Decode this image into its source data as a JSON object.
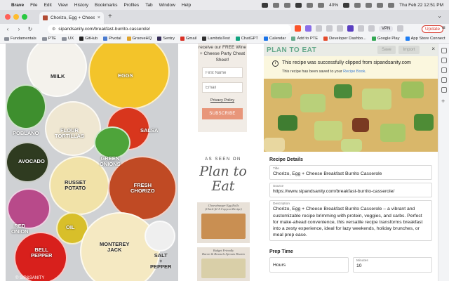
{
  "menubar": {
    "apple": "",
    "app_name": "Brave",
    "items": [
      "File",
      "Edit",
      "View",
      "History",
      "Bookmarks",
      "Profiles",
      "Tab",
      "Window",
      "Help"
    ],
    "battery": "40%",
    "clock": "Thu Feb 22  12:51 PM"
  },
  "tab": {
    "title": "Chorizo, Egg + Cheese Breakfast Burrito Casserole",
    "close": "×",
    "new_tab": "+",
    "dropdown": "⌄"
  },
  "addressbar": {
    "back": "‹",
    "forward": "›",
    "reload": "↻",
    "url": "sipandsanity.com/breakfast-burrito-casserole/",
    "vpn": "VPN",
    "update_label": "Update",
    "menu": "≡"
  },
  "bookmarks": [
    {
      "label": "Fundamentals",
      "kind": "folder"
    },
    {
      "label": "PTE",
      "kind": "folder"
    },
    {
      "label": "UX",
      "kind": "folder"
    },
    {
      "label": "GitHub",
      "kind": "site",
      "color": "#222222"
    },
    {
      "label": "Pivotal",
      "kind": "site",
      "color": "#4a7bd0"
    },
    {
      "label": "GrooveHQ",
      "kind": "site",
      "color": "#e0a42b"
    },
    {
      "label": "Sentry",
      "kind": "site",
      "color": "#362d59"
    },
    {
      "label": "Gmail",
      "kind": "site",
      "color": "#d93025"
    },
    {
      "label": "LambdaTest",
      "kind": "site",
      "color": "#2f2f2f"
    },
    {
      "label": "ChatGPT",
      "kind": "site",
      "color": "#10a37f"
    },
    {
      "label": "Calendar",
      "kind": "site",
      "color": "#1a73e8"
    },
    {
      "label": "Add to PTE",
      "kind": "site",
      "color": "#64a88a"
    },
    {
      "label": "Developer Dashbo...",
      "kind": "site",
      "color": "#e44a2b"
    },
    {
      "label": "Google Play",
      "kind": "site",
      "color": "#34a853"
    },
    {
      "label": "App Store Connect",
      "kind": "site",
      "color": "#1c7cf3"
    }
  ],
  "photo": {
    "ingredients": [
      "MIILK",
      "EGGS",
      "POBLANO",
      "FLOUR\nTORTILLAS",
      "SALSA",
      "AVOCADO",
      "GREEN\nONIONS",
      "RUSSET\nPOTATO",
      "FRESH\nCHORIZO",
      "RED\nONION",
      "OIL",
      "BELL\nPEPPER",
      "MONTEREY\nJACK",
      "SALT\n+\nPEPPER"
    ],
    "credit": "© SIP&SANITY"
  },
  "sidebar": {
    "signup_text": "receive our FREE Wine + Cheese Party Cheat Sheet!",
    "first_name_placeholder": "First Name",
    "email_placeholder": "Email",
    "privacy_label": "Privacy Policy",
    "subscribe_label": "SUBSCRIBE",
    "as_seen_on": "AS SEEN ON",
    "brand_line1": "Plan to",
    "brand_line2": "Eat",
    "thumb1_caption": "Cheeseburger Egg Rolls\n(Chick-fil-A Copycat Recipe)",
    "thumb2_caption": "Budget Friendly\nBacon & Brussels Sprouts Risotto"
  },
  "panel": {
    "logo": "PLAN TO EAT",
    "save_label": "Save",
    "import_label": "Import",
    "close": "×",
    "notice_icon": "i",
    "notice_title": "This recipe was successfully clipped from sipandsanity.com",
    "notice_sub_prefix": "This recipe has been saved to your ",
    "notice_sub_link": "Recipe Book",
    "notice_sub_suffix": ".",
    "recipe_details_heading": "Recipe Details",
    "title_label": "Title",
    "title_value": "Chorizo, Egg + Cheese Breakfast Burrito Casserole",
    "source_label": "Source",
    "source_value": "https://www.sipandsanity.com/breakfast-burrito-casserole/",
    "description_label": "Description",
    "description_value": "Chorizo, Egg + Cheese Breakfast Burrito Casserole – a vibrant and customizable recipe brimming with protein, veggies, and carbs. Perfect for make-ahead convenience, this versatile recipe transforms breakfast into a zesty experience, ideal for lazy weekends, holiday brunches, or meal prep ease.",
    "prep_time_heading": "Prep Time",
    "hours_placeholder": "Hours",
    "minutes_label": "Minutes",
    "minutes_value": "10"
  },
  "colors": {
    "accent_green": "#64a88a",
    "notice_bg": "#fbf7de",
    "update_red": "#d83a2e",
    "subscribe_orange": "#e8967a"
  }
}
